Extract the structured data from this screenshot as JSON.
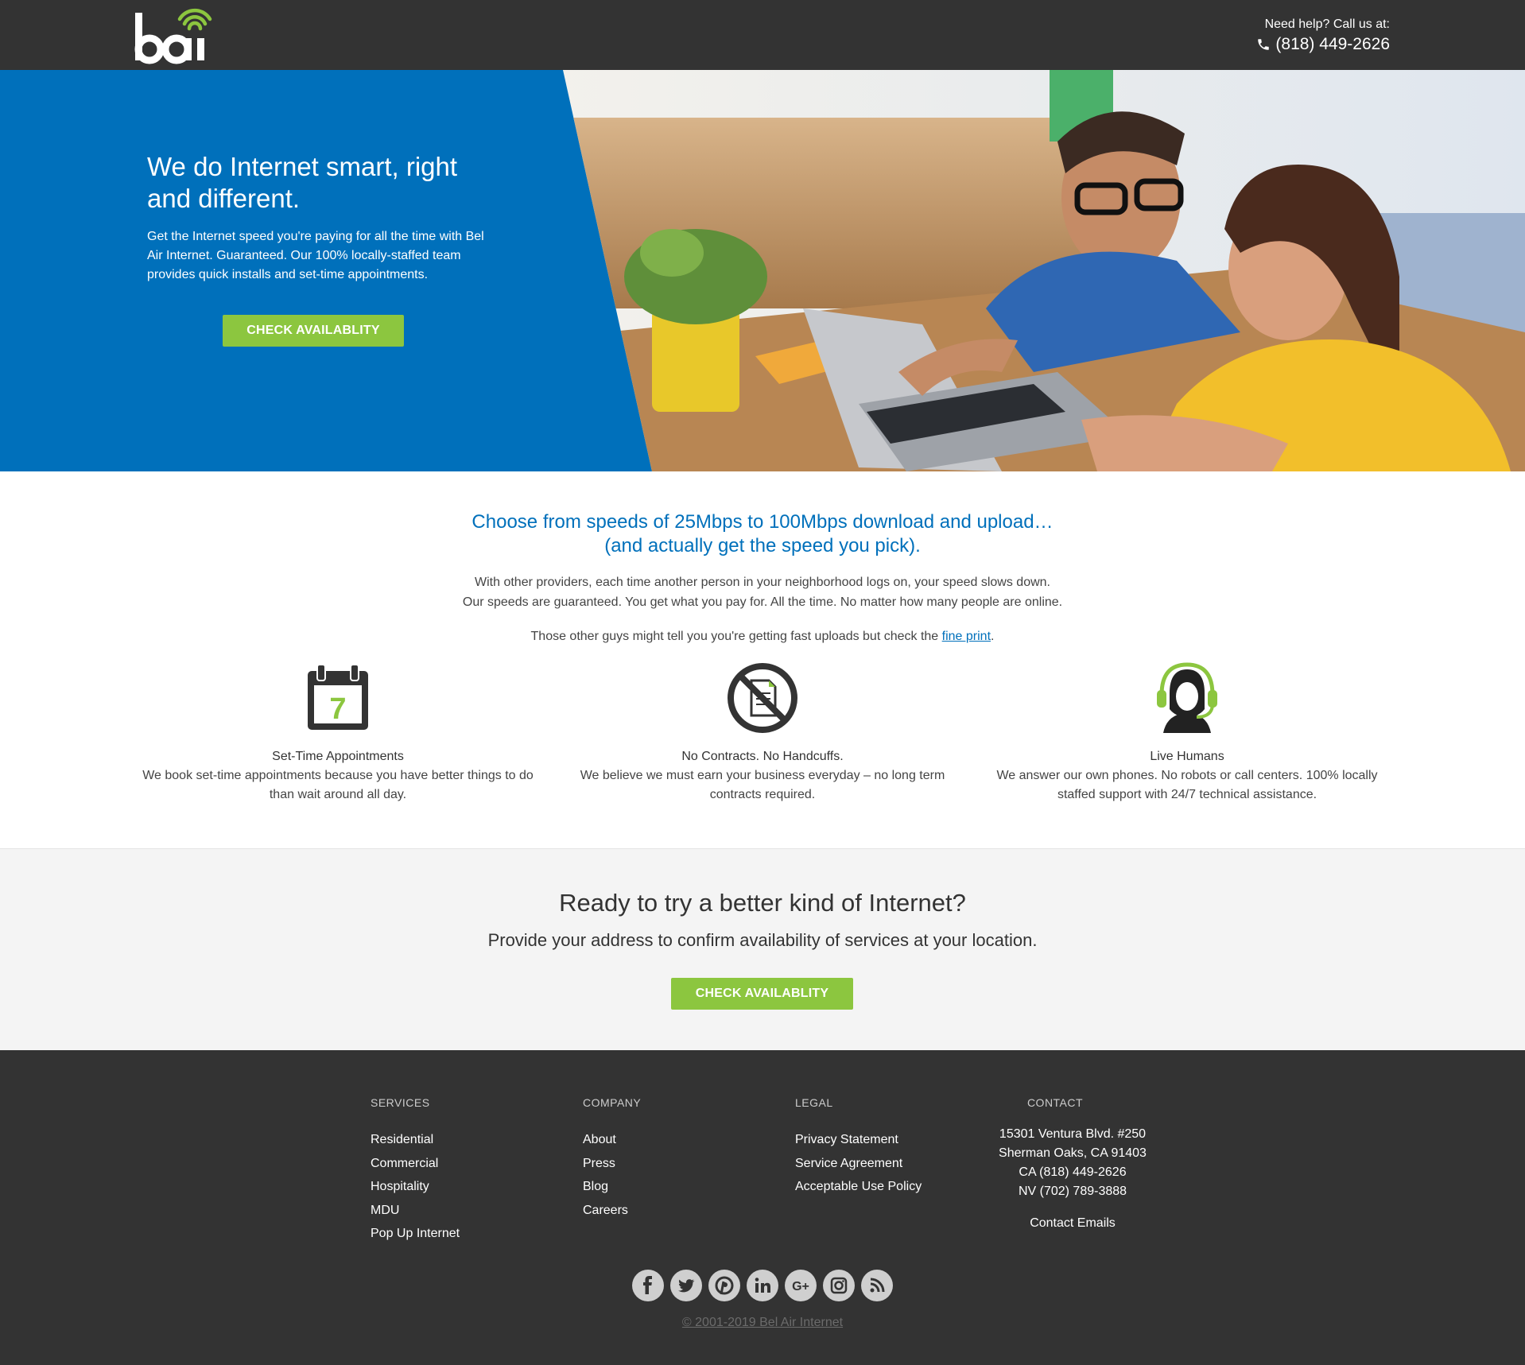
{
  "header": {
    "logo_text": "bai",
    "help_label": "Need help? Call us at:",
    "phone": "(818) 449-2626"
  },
  "hero": {
    "title": "We do Internet smart, right and different.",
    "text": "Get the Internet speed you're paying for all the time with Bel Air Internet. Guaranteed. Our 100% locally-staffed team provides quick installs and set-time appointments.",
    "button": "CHECK AVAILABLITY"
  },
  "speeds": {
    "title_line1": "Choose from speeds of 25Mbps to 100Mbps download and upload…",
    "title_line2": "(and actually get the speed you pick).",
    "text_line1": "With other providers, each time another person in your neighborhood logs on, your speed slows down.",
    "text_line2": "Our speeds are guaranteed. You get what you pay for. All the time. No matter how many people are online.",
    "fine_print_prefix": "Those other guys might tell you you're getting fast uploads but check the ",
    "fine_print_link": "fine print",
    "fine_print_suffix": "."
  },
  "features": [
    {
      "title": "Set-Time Appointments",
      "text": "We book set-time appointments because you have better things to do than wait around all day.",
      "icon": "calendar-icon",
      "icon_number": "7"
    },
    {
      "title": "No Contracts. No Handcuffs.",
      "text": "We believe we must earn your business everyday – no long term contracts required.",
      "icon": "no-contract-icon"
    },
    {
      "title": "Live Humans",
      "text": "We answer our own phones. No robots or call centers. 100% locally staffed support with 24/7 technical assistance.",
      "icon": "headset-person-icon"
    }
  ],
  "cta": {
    "title": "Ready to try a better kind of Internet?",
    "text": "Provide your address to confirm availability of services at your location.",
    "button": "CHECK AVAILABLITY"
  },
  "footer": {
    "services": {
      "heading": "SERVICES",
      "items": [
        "Residential",
        "Commercial",
        "Hospitality",
        "MDU",
        "Pop Up Internet"
      ]
    },
    "company": {
      "heading": "COMPANY",
      "items": [
        "About",
        "Press",
        "Blog",
        "Careers"
      ]
    },
    "legal": {
      "heading": "LEGAL",
      "items": [
        "Privacy Statement",
        "Service Agreement",
        "Acceptable Use Policy"
      ]
    },
    "contact": {
      "heading": "CONTACT",
      "lines": [
        "15301 Ventura Blvd. #250",
        "Sherman Oaks, CA 91403",
        "CA (818) 449-2626",
        "NV (702) 789-3888"
      ],
      "emails_link": "Contact Emails"
    },
    "social": [
      "facebook-icon",
      "twitter-icon",
      "pinterest-icon",
      "linkedin-icon",
      "google-plus-icon",
      "instagram-icon",
      "rss-icon"
    ],
    "copyright": "© 2001-2019 Bel Air Internet"
  },
  "colors": {
    "header_bg": "#333333",
    "hero_blue": "#0070bb",
    "accent_green": "#8cc63f",
    "cta_bg": "#f4f4f4",
    "footer_bg": "#333333"
  }
}
